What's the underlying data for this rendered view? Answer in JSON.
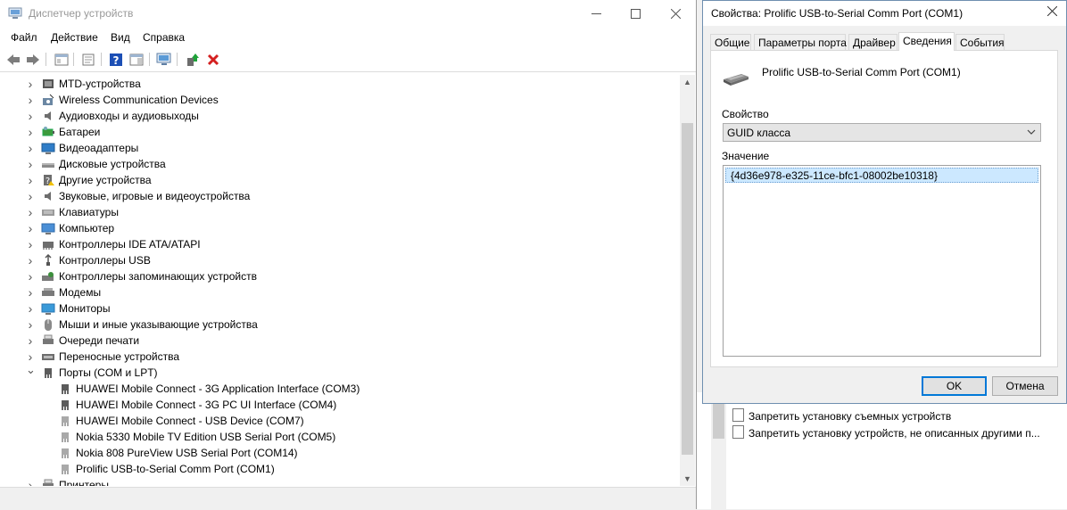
{
  "device_manager": {
    "title": "Диспетчер устройств",
    "menu": [
      "Файл",
      "Действие",
      "Вид",
      "Справка"
    ],
    "tree": [
      {
        "label": "MTD-устройства",
        "icon": "mtd-device-icon",
        "expanded": false,
        "level": 0
      },
      {
        "label": "Wireless Communication Devices",
        "icon": "wireless-device-icon",
        "expanded": false,
        "level": 0
      },
      {
        "label": "Аудиовходы и аудиовыходы",
        "icon": "speaker-icon",
        "expanded": false,
        "level": 0
      },
      {
        "label": "Батареи",
        "icon": "battery-icon",
        "expanded": false,
        "level": 0
      },
      {
        "label": "Видеоадаптеры",
        "icon": "display-adapter-icon",
        "expanded": false,
        "level": 0
      },
      {
        "label": "Дисковые устройства",
        "icon": "disk-drive-icon",
        "expanded": false,
        "level": 0
      },
      {
        "label": "Другие устройства",
        "icon": "unknown-device-icon",
        "expanded": false,
        "level": 0
      },
      {
        "label": "Звуковые, игровые и видеоустройства",
        "icon": "speaker-icon",
        "expanded": false,
        "level": 0
      },
      {
        "label": "Клавиатуры",
        "icon": "keyboard-icon",
        "expanded": false,
        "level": 0
      },
      {
        "label": "Компьютер",
        "icon": "computer-icon",
        "expanded": false,
        "level": 0
      },
      {
        "label": "Контроллеры IDE ATA/ATAPI",
        "icon": "ide-controller-icon",
        "expanded": false,
        "level": 0
      },
      {
        "label": "Контроллеры USB",
        "icon": "usb-icon",
        "expanded": false,
        "level": 0
      },
      {
        "label": "Контроллеры запоминающих устройств",
        "icon": "storage-controller-icon",
        "expanded": false,
        "level": 0
      },
      {
        "label": "Модемы",
        "icon": "modem-icon",
        "expanded": false,
        "level": 0
      },
      {
        "label": "Мониторы",
        "icon": "monitor-icon",
        "expanded": false,
        "level": 0
      },
      {
        "label": "Мыши и иные указывающие устройства",
        "icon": "mouse-icon",
        "expanded": false,
        "level": 0
      },
      {
        "label": "Очереди печати",
        "icon": "print-queue-icon",
        "expanded": false,
        "level": 0
      },
      {
        "label": "Переносные устройства",
        "icon": "portable-device-icon",
        "expanded": false,
        "level": 0
      },
      {
        "label": "Порты (COM и LPT)",
        "icon": "port-icon",
        "expanded": true,
        "level": 0
      },
      {
        "label": "HUAWEI Mobile Connect - 3G Application Interface (COM3)",
        "icon": "port-icon",
        "level": 1
      },
      {
        "label": "HUAWEI Mobile Connect - 3G PC UI Interface (COM4)",
        "icon": "port-icon",
        "level": 1
      },
      {
        "label": "HUAWEI Mobile Connect - USB Device (COM7)",
        "icon": "port-icon-dimmed",
        "level": 1
      },
      {
        "label": "Nokia 5330 Mobile TV Edition USB Serial Port (COM5)",
        "icon": "port-icon-dimmed",
        "level": 1
      },
      {
        "label": "Nokia 808 PureView USB Serial Port (COM14)",
        "icon": "port-icon-dimmed",
        "level": 1
      },
      {
        "label": "Prolific USB-to-Serial Comm Port (COM1)",
        "icon": "port-icon-dimmed",
        "level": 1
      },
      {
        "label": "Принтеры",
        "icon": "printer-icon",
        "expanded": false,
        "level": 0
      }
    ]
  },
  "background_window": {
    "items": [
      "Запретить установку съемных устройств",
      "Запретить установку устройств, не описанных другими п..."
    ]
  },
  "properties_dialog": {
    "title": "Свойства: Prolific USB-to-Serial Comm Port (COM1)",
    "tabs": [
      "Общие",
      "Параметры порта",
      "Драйвер",
      "Сведения",
      "События"
    ],
    "active_tab": "Сведения",
    "device_name": "Prolific USB-to-Serial Comm Port (COM1)",
    "property_label": "Свойство",
    "property_value": "GUID класса",
    "value_label": "Значение",
    "values": [
      "{4d36e978-e325-11ce-bfc1-08002be10318}"
    ],
    "ok_label": "OK",
    "cancel_label": "Отмена"
  },
  "colors": {
    "accent": "#0078d7",
    "selection": "#cce8ff",
    "delete_icon": "#d42020",
    "help_icon": "#1c4fb5"
  }
}
